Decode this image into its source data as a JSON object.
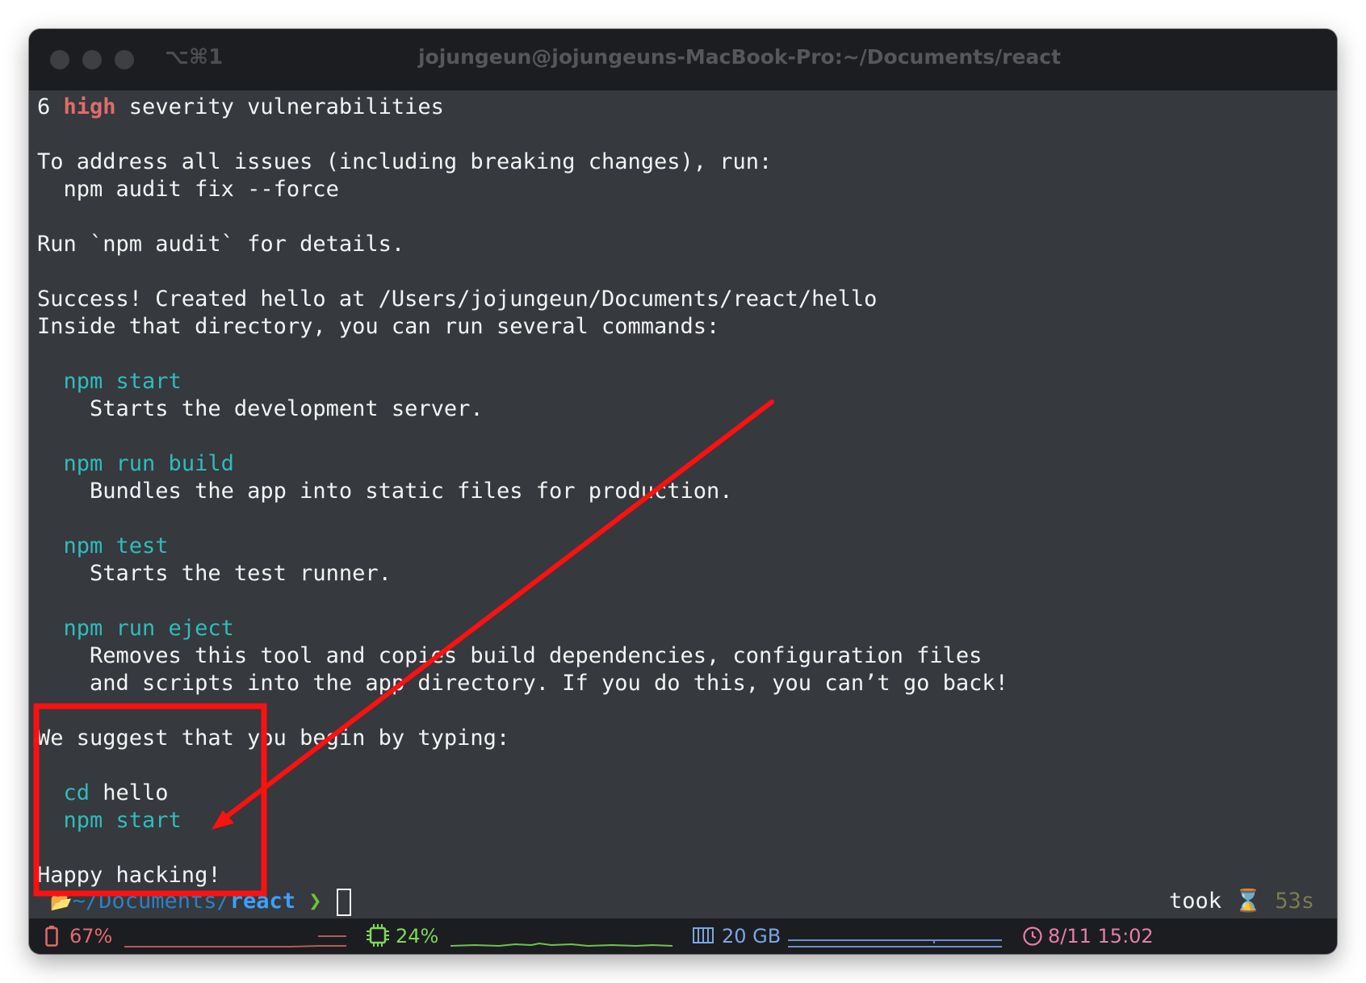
{
  "window": {
    "shortcut": "⌥⌘1",
    "title": "jojungeun@jojungeuns-MacBook-Pro:~/Documents/react"
  },
  "terminal": {
    "l0_prefix": "6 ",
    "l0_high": "high",
    "l0_rest": " severity vulnerabilities",
    "l2": "To address all issues (including breaking changes), run:",
    "l3": "  npm audit fix --force",
    "l5": "Run `npm audit` for details.",
    "l7": "Success! Created hello at /Users/jojungeun/Documents/react/hello",
    "l8": "Inside that directory, you can run several commands:",
    "cmd_start": "npm start",
    "desc_start": "    Starts the development server.",
    "cmd_build": "npm run build",
    "desc_build": "    Bundles the app into static files for production.",
    "cmd_test": "npm test",
    "desc_test": "    Starts the test runner.",
    "cmd_eject": "npm run eject",
    "desc_eject_1": "    Removes this tool and copies build dependencies, configuration files",
    "desc_eject_2": "    and scripts into the app directory. If you do this, you can’t go back!",
    "suggest": "We suggest that you begin by typing:",
    "cd_cmd": "cd",
    "cd_arg": " hello",
    "npm_start_final": "npm start",
    "happy": "Happy hacking!"
  },
  "prompt": {
    "path": "~/Documents/",
    "dir": "react",
    "chevron": "❯",
    "took_label": "took",
    "duration": "53s"
  },
  "status": {
    "battery": "67%",
    "cpu": "24%",
    "memory": "20 GB",
    "datetime": "8/11 15:02"
  },
  "colors": {
    "terminal_bg": "#36393e",
    "accent_cyan": "#2fbcbc",
    "annotation_red": "#ff1010"
  }
}
